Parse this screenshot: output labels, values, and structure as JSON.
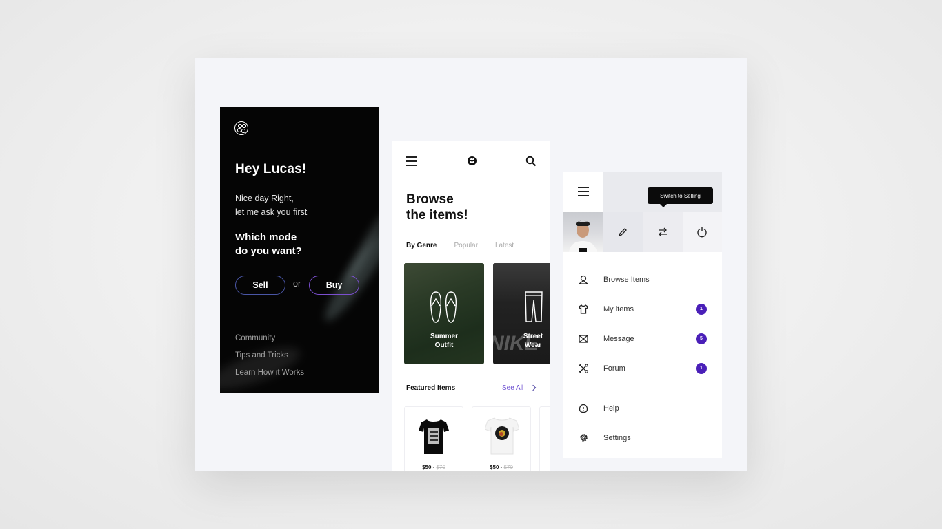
{
  "welcome_screen": {
    "greeting": "Hey Lucas!",
    "subtitle_line1": "Nice day Right,",
    "subtitle_line2": "let me ask you first",
    "question_line1": "Which mode",
    "question_line2": "do you want?",
    "sell_label": "Sell",
    "or_label": "or",
    "buy_label": "Buy",
    "links": [
      "Community",
      "Tips and Tricks",
      "Learn How it Works"
    ]
  },
  "browse_screen": {
    "title_line1": "Browse",
    "title_line2": "the items!",
    "tabs": [
      {
        "label": "By Genre",
        "active": true
      },
      {
        "label": "Popular",
        "active": false
      },
      {
        "label": "Latest",
        "active": false
      }
    ],
    "categories": [
      {
        "line1": "Summer",
        "line2": "Outfit",
        "icon": "flip-flops-icon"
      },
      {
        "line1": "Street",
        "line2": "Wear",
        "icon": "pants-icon"
      }
    ],
    "featured_title": "Featured Items",
    "see_all_label": "See All",
    "products": [
      {
        "price": "$50",
        "old_price": "$70",
        "separator": " - ",
        "image": "black-tshirt"
      },
      {
        "price": "$50",
        "old_price": "$70",
        "separator": " - ",
        "image": "white-tshirt"
      }
    ]
  },
  "menu_screen": {
    "tooltip": "Switch to Selling",
    "items": [
      {
        "label": "Browse Items",
        "icon": "hanger-icon",
        "badge": null
      },
      {
        "label": "My items",
        "icon": "tshirt-icon",
        "badge": "1"
      },
      {
        "label": "Message",
        "icon": "envelope-icon",
        "badge": "5"
      },
      {
        "label": "Forum",
        "icon": "network-icon",
        "badge": "1"
      }
    ],
    "secondary_items": [
      {
        "label": "Help",
        "icon": "help-icon"
      },
      {
        "label": "Settings",
        "icon": "gear-icon"
      }
    ]
  },
  "colors": {
    "accent": "#6c4fd1",
    "badge": "#4a1fb8",
    "sell_border": "#4a56a6",
    "buy_border": "#7b4fcf"
  }
}
